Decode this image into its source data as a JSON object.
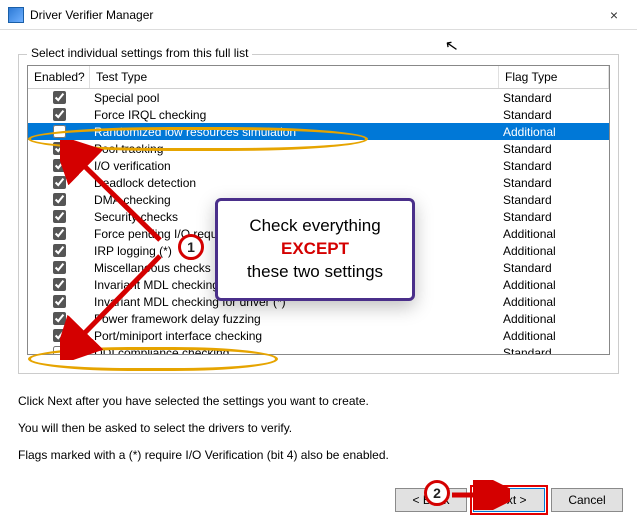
{
  "window": {
    "title": "Driver Verifier Manager",
    "close_label": "×"
  },
  "group_label": "Select individual settings from this full list",
  "columns": {
    "enabled": "Enabled?",
    "test": "Test Type",
    "flag": "Flag Type"
  },
  "rows": [
    {
      "checked": true,
      "test": "Special pool",
      "flag": "Standard",
      "selected": false
    },
    {
      "checked": true,
      "test": "Force IRQL checking",
      "flag": "Standard",
      "selected": false
    },
    {
      "checked": false,
      "test": "Randomized low resources simulation",
      "flag": "Additional",
      "selected": true
    },
    {
      "checked": true,
      "test": "Pool tracking",
      "flag": "Standard",
      "selected": false
    },
    {
      "checked": true,
      "test": "I/O verification",
      "flag": "Standard",
      "selected": false
    },
    {
      "checked": true,
      "test": "Deadlock detection",
      "flag": "Standard",
      "selected": false
    },
    {
      "checked": true,
      "test": "DMA checking",
      "flag": "Standard",
      "selected": false
    },
    {
      "checked": true,
      "test": "Security checks",
      "flag": "Standard",
      "selected": false
    },
    {
      "checked": true,
      "test": "Force pending I/O requests (*)",
      "flag": "Additional",
      "selected": false
    },
    {
      "checked": true,
      "test": "IRP logging (*)",
      "flag": "Additional",
      "selected": false
    },
    {
      "checked": true,
      "test": "Miscellaneous checks",
      "flag": "Standard",
      "selected": false
    },
    {
      "checked": true,
      "test": "Invariant MDL checking for stack (*)",
      "flag": "Additional",
      "selected": false
    },
    {
      "checked": true,
      "test": "Invariant MDL checking for driver (*)",
      "flag": "Additional",
      "selected": false
    },
    {
      "checked": true,
      "test": "Power framework delay fuzzing",
      "flag": "Additional",
      "selected": false
    },
    {
      "checked": true,
      "test": "Port/miniport interface checking",
      "flag": "Additional",
      "selected": false
    },
    {
      "checked": false,
      "test": "DDI compliance checking",
      "flag": "Standard",
      "selected": false
    }
  ],
  "instructions": {
    "line1": "Click Next after you have selected the settings you want to create.",
    "line2": "You will then be asked to select the drivers to verify.",
    "line3": "Flags marked with a (*) require I/O Verification (bit 4) also be enabled."
  },
  "buttons": {
    "back": "< Back",
    "next": "Next >",
    "cancel": "Cancel"
  },
  "annotation": {
    "callout_pre": "Check everything ",
    "callout_except": "EXCEPT",
    "callout_post": "these two settings",
    "marker1": "1",
    "marker2": "2"
  }
}
